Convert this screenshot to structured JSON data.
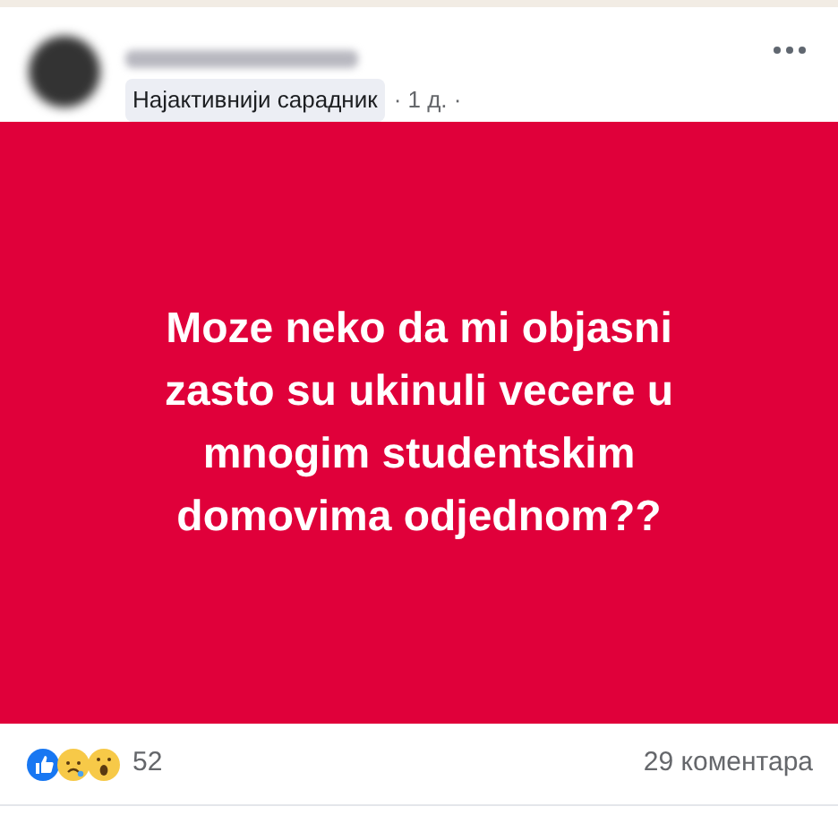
{
  "post": {
    "badge": "Најактивнији сарадник",
    "time": "· 1 д. ·",
    "text_lines": [
      "Moze neko da mi objasni",
      "zasto su ukinuli vecere u",
      "mnogim studentskim",
      "domovima odjednom??"
    ]
  },
  "reactions": {
    "count": "52",
    "comments": "29 коментара"
  }
}
